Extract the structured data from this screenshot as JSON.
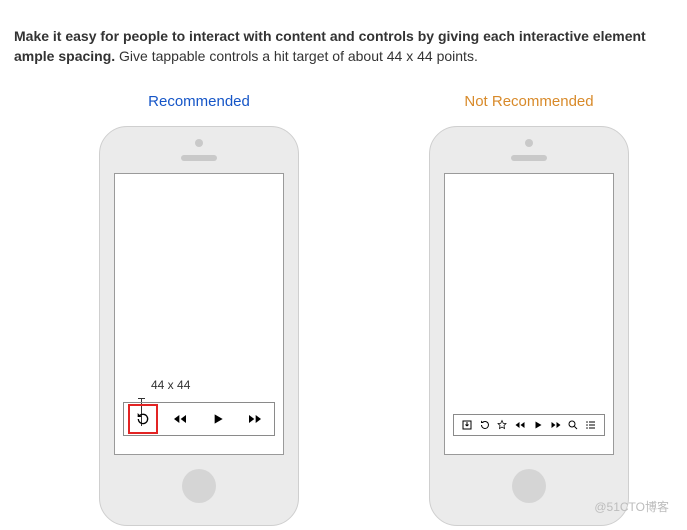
{
  "intro": {
    "bold": "Make it easy for people to interact with content and controls by giving each interactive element ample spacing.",
    "rest": " Give tappable controls a hit target of about 44 x 44 points."
  },
  "labels": {
    "recommended": "Recommended",
    "not_recommended": "Not Recommended",
    "callout": "44 x 44"
  },
  "watermark": "@51CTO博客"
}
